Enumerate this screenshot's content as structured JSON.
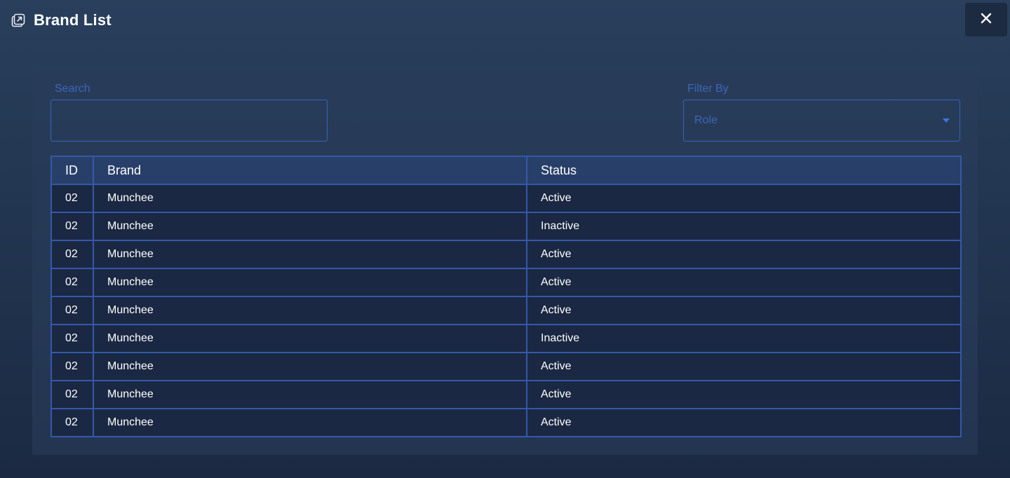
{
  "header": {
    "title": "Brand List",
    "title_icon": "external-window-icon",
    "close_icon": "close-x-icon"
  },
  "search": {
    "label": "Search",
    "value": "",
    "placeholder": ""
  },
  "filter": {
    "label": "Filter By",
    "selected": "Role",
    "icon": "caret-down-icon"
  },
  "table": {
    "columns": [
      "ID",
      "Brand",
      "Status"
    ],
    "rows": [
      {
        "id": "02",
        "brand": "Munchee",
        "status": "Active"
      },
      {
        "id": "02",
        "brand": "Munchee",
        "status": "Inactive"
      },
      {
        "id": "02",
        "brand": "Munchee",
        "status": "Active"
      },
      {
        "id": "02",
        "brand": "Munchee",
        "status": "Active"
      },
      {
        "id": "02",
        "brand": "Munchee",
        "status": "Active"
      },
      {
        "id": "02",
        "brand": "Munchee",
        "status": "Inactive"
      },
      {
        "id": "02",
        "brand": "Munchee",
        "status": "Active"
      },
      {
        "id": "02",
        "brand": "Munchee",
        "status": "Active"
      },
      {
        "id": "02",
        "brand": "Munchee",
        "status": "Active"
      }
    ]
  },
  "colors": {
    "accent": "#3763b8",
    "label": "#3d66b8",
    "header_bg": "#283f69",
    "row_bg": "#1b2843"
  }
}
